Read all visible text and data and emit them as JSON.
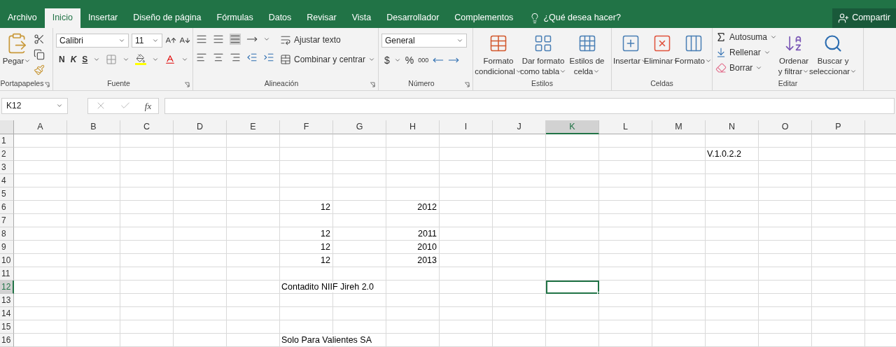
{
  "tabs": [
    {
      "label": "Archivo",
      "selected": false
    },
    {
      "label": "Inicio",
      "selected": true
    },
    {
      "label": "Insertar",
      "selected": false
    },
    {
      "label": "Diseño de página",
      "selected": false
    },
    {
      "label": "Fórmulas",
      "selected": false
    },
    {
      "label": "Datos",
      "selected": false
    },
    {
      "label": "Revisar",
      "selected": false
    },
    {
      "label": "Vista",
      "selected": false
    },
    {
      "label": "Desarrollador",
      "selected": false
    },
    {
      "label": "Complementos",
      "selected": false
    }
  ],
  "tell_me": "¿Qué desea hacer?",
  "share": "Compartir",
  "ribbon": {
    "clipboard": {
      "label": "Portapapeles",
      "paste": "Pegar"
    },
    "font": {
      "label": "Fuente",
      "font_name": "Calibri",
      "font_size": "11",
      "bold": "N",
      "italic": "K",
      "underline": "S"
    },
    "alignment": {
      "label": "Alineación",
      "wrap_text": "Ajustar texto",
      "merge": "Combinar y centrar"
    },
    "number": {
      "label": "Número",
      "format": "General",
      "currency": "$",
      "percent": "%",
      "thousands": "000"
    },
    "styles": {
      "label": "Estilos",
      "buttons": [
        {
          "lines": [
            "Formato",
            "condicional"
          ]
        },
        {
          "lines": [
            "Dar formato",
            "como tabla"
          ]
        },
        {
          "lines": [
            "Estilos de",
            "celda"
          ]
        }
      ]
    },
    "cells": {
      "label": "Celdas",
      "buttons": [
        "Insertar",
        "Eliminar",
        "Formato"
      ]
    },
    "editing": {
      "label": "Editar",
      "autosum": "Autosuma",
      "fill": "Rellenar",
      "clear": "Borrar",
      "sort": [
        "Ordenar",
        "y filtrar"
      ],
      "find": [
        "Buscar y",
        "seleccionar"
      ]
    }
  },
  "formula_bar": {
    "name_box": "K12",
    "function_label": "fx"
  },
  "columns": [
    {
      "label": "A",
      "selected": false
    },
    {
      "label": "B",
      "selected": false
    },
    {
      "label": "C",
      "selected": false
    },
    {
      "label": "D",
      "selected": false
    },
    {
      "label": "E",
      "selected": false
    },
    {
      "label": "F",
      "selected": false
    },
    {
      "label": "G",
      "selected": false
    },
    {
      "label": "H",
      "selected": false
    },
    {
      "label": "I",
      "selected": false
    },
    {
      "label": "J",
      "selected": false
    },
    {
      "label": "K",
      "selected": true
    },
    {
      "label": "L",
      "selected": false
    },
    {
      "label": "M",
      "selected": false
    },
    {
      "label": "N",
      "selected": false
    },
    {
      "label": "O",
      "selected": false
    },
    {
      "label": "P",
      "selected": false
    }
  ],
  "rows": [
    {
      "number": "1",
      "selected": false,
      "cells": [
        null,
        null,
        null,
        null,
        null,
        null,
        null,
        null,
        null,
        null,
        null,
        null,
        null,
        null,
        null,
        null
      ]
    },
    {
      "number": "2",
      "selected": false,
      "cells": [
        null,
        null,
        null,
        null,
        null,
        null,
        null,
        null,
        null,
        null,
        null,
        null,
        null,
        {
          "value": "V.1.0.2.2",
          "kind": "text"
        },
        null,
        null
      ]
    },
    {
      "number": "3",
      "selected": false,
      "cells": [
        null,
        null,
        null,
        null,
        null,
        null,
        null,
        null,
        null,
        null,
        null,
        null,
        null,
        null,
        null,
        null
      ]
    },
    {
      "number": "4",
      "selected": false,
      "cells": [
        null,
        null,
        null,
        null,
        null,
        null,
        null,
        null,
        null,
        null,
        null,
        null,
        null,
        null,
        null,
        null
      ]
    },
    {
      "number": "5",
      "selected": false,
      "cells": [
        null,
        null,
        null,
        null,
        null,
        null,
        null,
        null,
        null,
        null,
        null,
        null,
        null,
        null,
        null,
        null
      ]
    },
    {
      "number": "6",
      "selected": false,
      "cells": [
        null,
        null,
        null,
        null,
        null,
        {
          "value": "12",
          "kind": "number"
        },
        null,
        {
          "value": "2012",
          "kind": "number"
        },
        null,
        null,
        null,
        null,
        null,
        null,
        null,
        null
      ]
    },
    {
      "number": "7",
      "selected": false,
      "cells": [
        null,
        null,
        null,
        null,
        null,
        null,
        null,
        null,
        null,
        null,
        null,
        null,
        null,
        null,
        null,
        null
      ]
    },
    {
      "number": "8",
      "selected": false,
      "cells": [
        null,
        null,
        null,
        null,
        null,
        {
          "value": "12",
          "kind": "number"
        },
        null,
        {
          "value": "2011",
          "kind": "number"
        },
        null,
        null,
        null,
        null,
        null,
        null,
        null,
        null
      ]
    },
    {
      "number": "9",
      "selected": false,
      "cells": [
        null,
        null,
        null,
        null,
        null,
        {
          "value": "12",
          "kind": "number"
        },
        null,
        {
          "value": "2010",
          "kind": "number"
        },
        null,
        null,
        null,
        null,
        null,
        null,
        null,
        null
      ]
    },
    {
      "number": "10",
      "selected": false,
      "cells": [
        null,
        null,
        null,
        null,
        null,
        {
          "value": "12",
          "kind": "number"
        },
        null,
        {
          "value": "2013",
          "kind": "number"
        },
        null,
        null,
        null,
        null,
        null,
        null,
        null,
        null
      ]
    },
    {
      "number": "11",
      "selected": false,
      "cells": [
        null,
        null,
        null,
        null,
        null,
        null,
        null,
        null,
        null,
        null,
        null,
        null,
        null,
        null,
        null,
        null
      ]
    },
    {
      "number": "12",
      "selected": true,
      "cells": [
        null,
        null,
        null,
        null,
        null,
        {
          "value": "Contadito NIIF Jireh 2.0",
          "kind": "text"
        },
        null,
        null,
        null,
        null,
        null,
        null,
        null,
        null,
        null,
        null
      ]
    },
    {
      "number": "13",
      "selected": false,
      "cells": [
        null,
        null,
        null,
        null,
        null,
        null,
        null,
        null,
        null,
        null,
        null,
        null,
        null,
        null,
        null,
        null
      ]
    },
    {
      "number": "14",
      "selected": false,
      "cells": [
        null,
        null,
        null,
        null,
        null,
        null,
        null,
        null,
        null,
        null,
        null,
        null,
        null,
        null,
        null,
        null
      ]
    },
    {
      "number": "15",
      "selected": false,
      "cells": [
        null,
        null,
        null,
        null,
        null,
        null,
        null,
        null,
        null,
        null,
        null,
        null,
        null,
        null,
        null,
        null
      ]
    },
    {
      "number": "16",
      "selected": false,
      "cells": [
        null,
        null,
        null,
        null,
        null,
        {
          "value": "Solo Para Valientes SA",
          "kind": "text"
        },
        null,
        null,
        null,
        null,
        null,
        null,
        null,
        null,
        null,
        null
      ]
    }
  ]
}
